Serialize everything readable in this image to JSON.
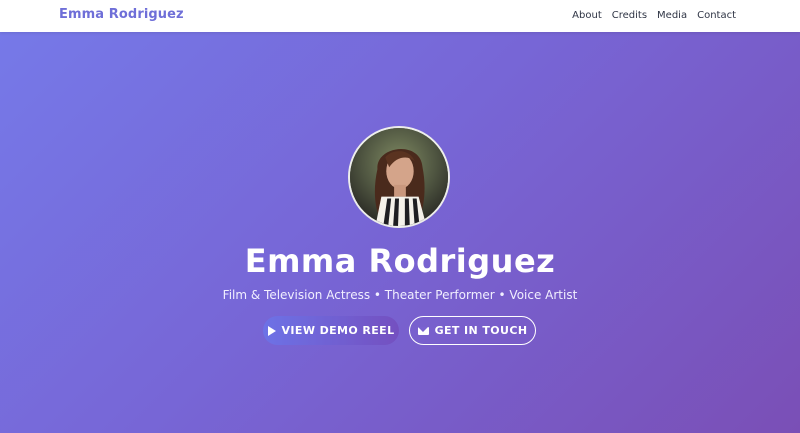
{
  "nav": {
    "brand": "Emma Rodriguez",
    "links": [
      "About",
      "Credits",
      "Media",
      "Contact"
    ]
  },
  "hero": {
    "name": "Emma Rodriguez",
    "subtitle": "Film & Television Actress • Theater Performer • Voice Artist",
    "primary_button": "VIEW DEMO REEL",
    "secondary_button": "GET IN TOUCH",
    "primary_icon": "play-icon",
    "secondary_icon": "envelope-icon"
  },
  "colors": {
    "brand": "#6f6fd8",
    "gradient_start": "#7679e8",
    "gradient_end": "#7a4fb6",
    "text_light": "#ffffff"
  }
}
